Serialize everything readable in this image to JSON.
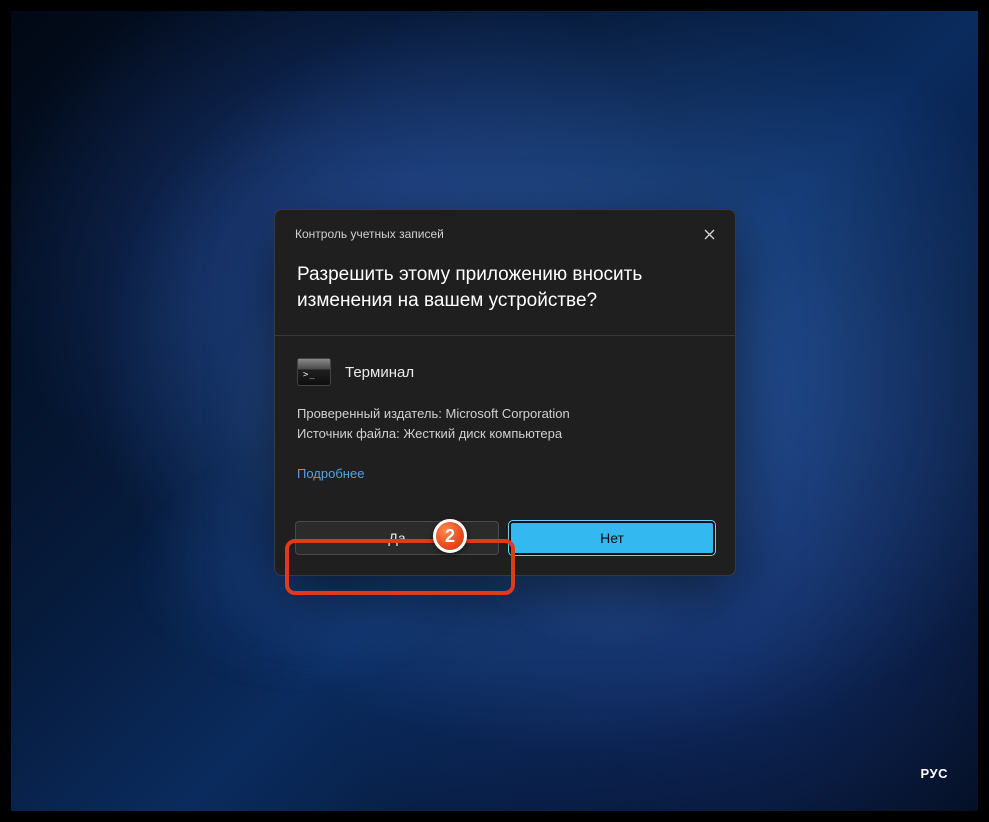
{
  "dialog": {
    "title": "Контроль учетных записей",
    "prompt": "Разрешить этому приложению вносить изменения на вашем устройстве?",
    "app_name": "Терминал",
    "publisher_line": "Проверенный издатель: Microsoft Corporation",
    "source_line": "Источник файла: Жесткий диск компьютера",
    "more_link": "Подробнее",
    "yes_label": "Да",
    "no_label": "Нет"
  },
  "annotation": {
    "badge": "2"
  },
  "taskbar": {
    "language": "РУС"
  }
}
